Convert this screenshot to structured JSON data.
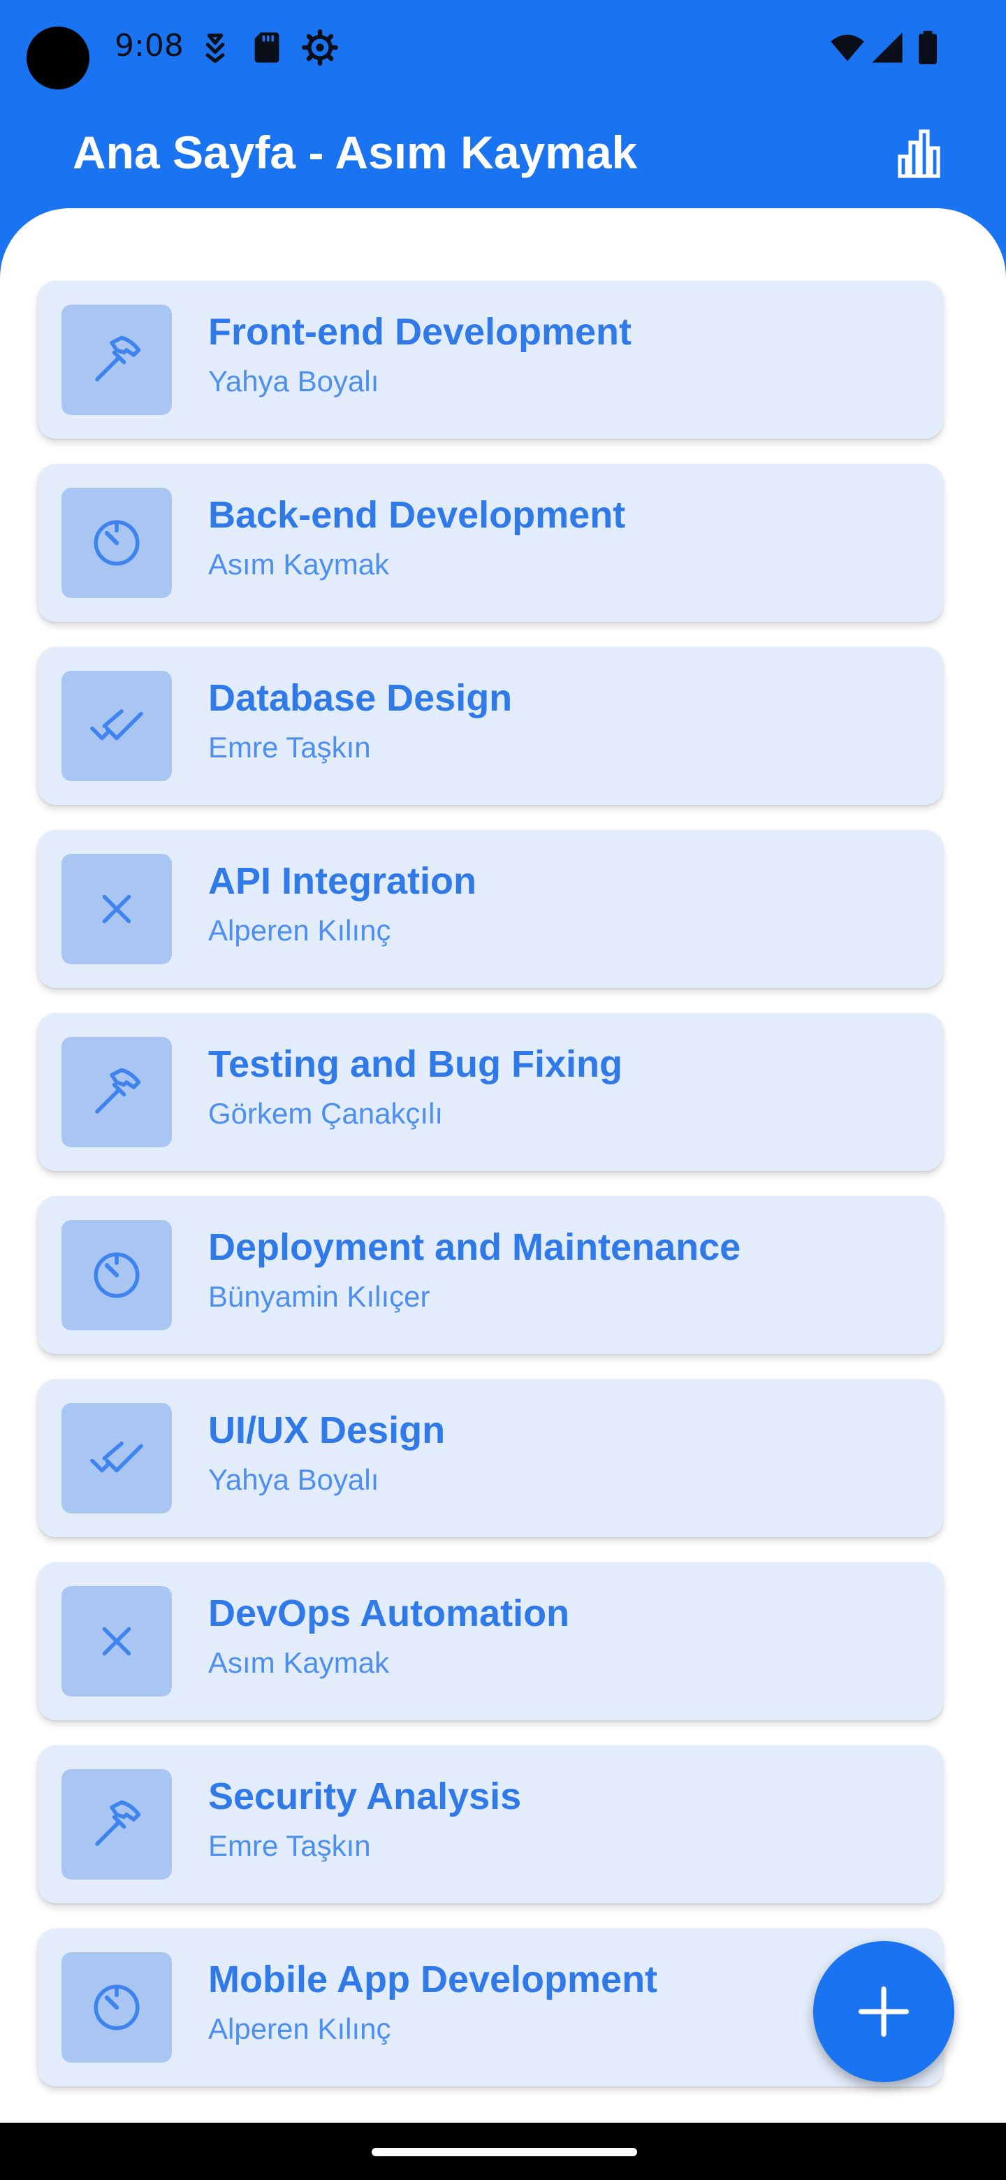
{
  "status_bar": {
    "time": "9:08",
    "left_icons": [
      "download-arrow-icon",
      "sd-card-icon",
      "settings-gear-icon"
    ],
    "right_icons": [
      "wifi-icon",
      "cellular-signal-icon",
      "battery-icon"
    ]
  },
  "app_bar": {
    "title": "Ana Sayfa - Asım Kaymak",
    "action_icon": "bar-chart-icon"
  },
  "tasks": [
    {
      "title": "Front-end Development",
      "assignee": "Yahya Boyalı",
      "icon": "hammer-icon"
    },
    {
      "title": "Back-end Development",
      "assignee": "Asım Kaymak",
      "icon": "timer-icon"
    },
    {
      "title": "Database Design",
      "assignee": "Emre Taşkın",
      "icon": "double-check-icon"
    },
    {
      "title": "API Integration",
      "assignee": "Alperen Kılınç",
      "icon": "close-x-icon"
    },
    {
      "title": "Testing and Bug Fixing",
      "assignee": "Görkem Çanakçılı",
      "icon": "hammer-icon"
    },
    {
      "title": "Deployment and Maintenance",
      "assignee": "Bünyamin Kılıçer",
      "icon": "timer-icon"
    },
    {
      "title": "UI/UX Design",
      "assignee": "Yahya Boyalı",
      "icon": "double-check-icon"
    },
    {
      "title": "DevOps Automation",
      "assignee": "Asım Kaymak",
      "icon": "close-x-icon"
    },
    {
      "title": "Security Analysis",
      "assignee": "Emre Taşkın",
      "icon": "hammer-icon"
    },
    {
      "title": "Mobile App Development",
      "assignee": "Alperen Kılınç",
      "icon": "timer-icon"
    }
  ],
  "fab": {
    "icon": "plus-icon"
  },
  "colors": {
    "primary": "#1a73f0",
    "card_background": "#e3ecfb",
    "icon_box": "#a9c6f3",
    "title_text": "#2f79e8",
    "subtitle_text": "#4d8ff0"
  }
}
